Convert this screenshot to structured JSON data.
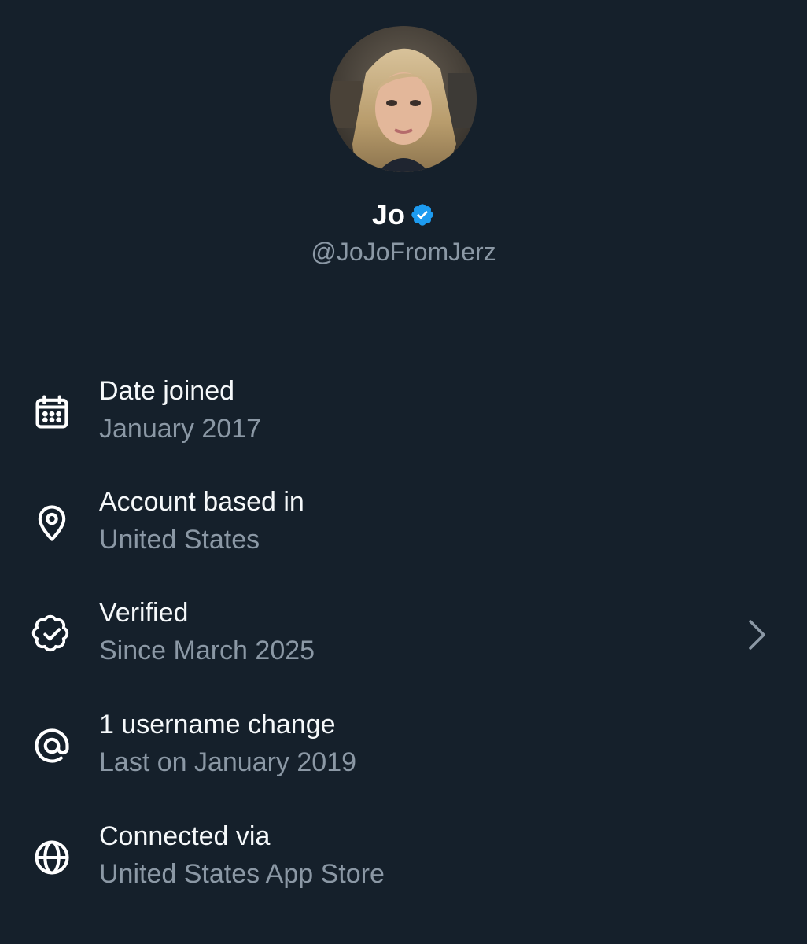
{
  "profile": {
    "display_name": "Jo",
    "handle": "@JoJoFromJerz"
  },
  "colors": {
    "background": "#15202b",
    "primary_text": "#ffffff",
    "secondary_text": "#8b98a5",
    "verified_blue": "#1d9bf0"
  },
  "icons": {
    "verified_badge": "verified-badge-icon",
    "calendar": "calendar-icon",
    "location": "location-pin-icon",
    "verified": "verified-outline-icon",
    "username": "at-sign-icon",
    "connected": "globe-icon",
    "chevron": "chevron-right-icon"
  },
  "details": [
    {
      "title": "Date joined",
      "subtitle": "January 2017"
    },
    {
      "title": "Account based in",
      "subtitle": "United States"
    },
    {
      "title": "Verified",
      "subtitle": "Since March 2025"
    },
    {
      "title": "1 username change",
      "subtitle": "Last on January 2019"
    },
    {
      "title": "Connected via",
      "subtitle": "United States App Store"
    }
  ]
}
